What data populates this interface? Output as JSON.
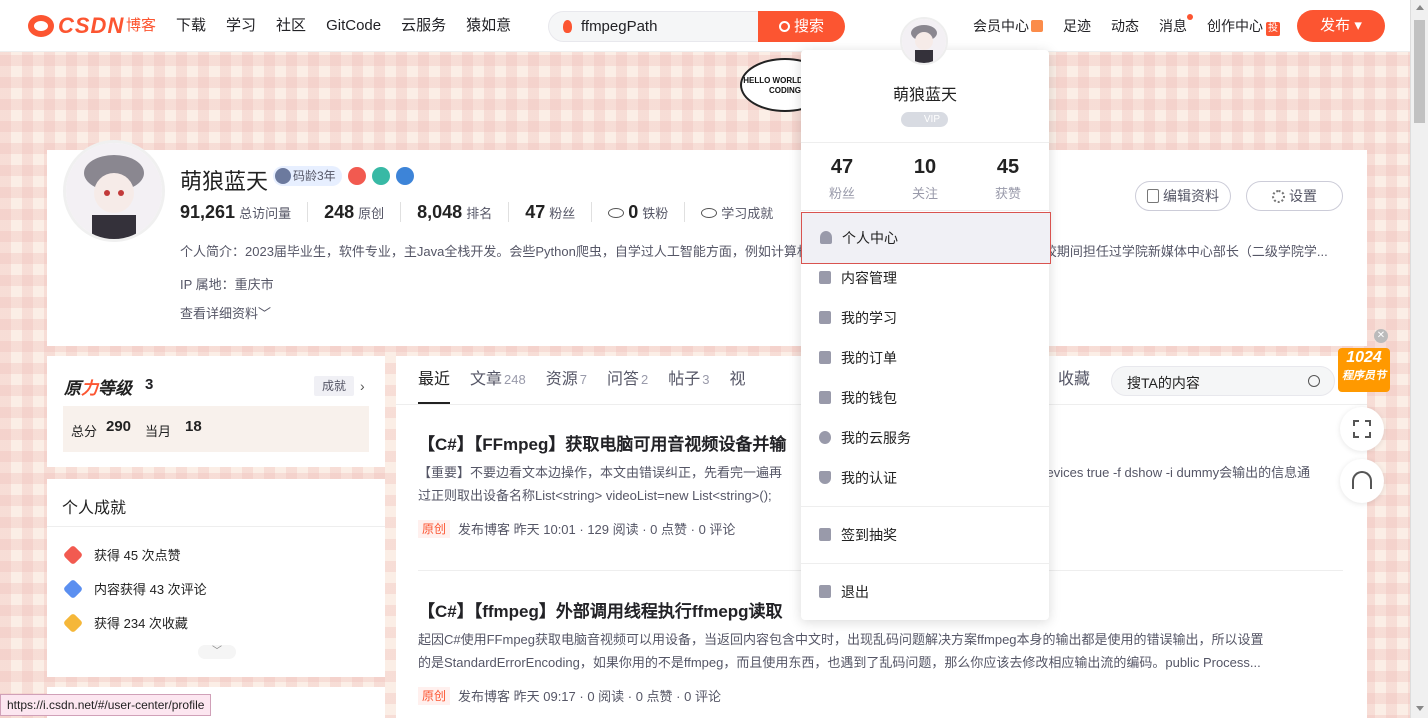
{
  "header": {
    "logo": "CSDN",
    "nav": [
      "博客",
      "下载",
      "学习",
      "社区",
      "GitCode",
      "云服务",
      "猿如意"
    ],
    "search_value": "ffmpegPath",
    "search_button": "搜索",
    "links": [
      "会员中心",
      "足迹",
      "动态",
      "消息",
      "创作中心"
    ],
    "creator_badge": "投",
    "publish": "发布"
  },
  "bubble_text": "HELLO WORLD KEEP CODING",
  "profile": {
    "username": "萌狼蓝天",
    "code_age": "码龄3年",
    "stats": [
      {
        "num": "91,261",
        "label": "总访问量"
      },
      {
        "num": "248",
        "label": "原创"
      },
      {
        "num": "8,048",
        "label": "排名"
      },
      {
        "num": "47",
        "label": "粉丝"
      },
      {
        "num": "0",
        "label": "铁粉"
      }
    ],
    "learning": "学习成就",
    "edit_btn": "编辑资料",
    "settings_btn": "设置",
    "intro": "个人简介：2023届毕业生，软件专业，主Java全栈开发。会些Python爬虫，自学过人工智能方面，例如计算机视觉与自然语言处理方面的相关知识，在校期间担任过学院新媒体中心部长（二级学院学...",
    "ip": "IP 属地：重庆市",
    "more": "查看详细资料"
  },
  "level": {
    "title_a": "原",
    "title_b": "力",
    "title_c": "等级",
    "num": "3",
    "achv_btn": "成就",
    "total_label": "总分",
    "total": "290",
    "month_label": "当月",
    "month": "18"
  },
  "achievements": {
    "title": "个人成就",
    "items": [
      "获得 45 次点赞",
      "内容获得 43 次评论",
      "获得 234 次收藏"
    ]
  },
  "tabs": [
    {
      "label": "最近",
      "count": ""
    },
    {
      "label": "文章",
      "count": "248"
    },
    {
      "label": "资源",
      "count": "7"
    },
    {
      "label": "问答",
      "count": "2"
    },
    {
      "label": "帖子",
      "count": "3"
    },
    {
      "label": "视",
      "count": ""
    }
  ],
  "tab_fav": "收藏",
  "tab_search": "搜TA的内容",
  "articles": [
    {
      "title": "【C#】【FFmpeg】获取电脑可用音视频设备并输",
      "desc_a": "【重要】不要边看文本边操作，本文由错误纠正，先看完一遍再",
      "desc_a2": "_devices true -f dshow -i dummy会输出的信息通",
      "desc_b": "过正则取出设备名称List<string> videoList=new List<string>();",
      "tag": "原创",
      "meta": "发布博客 昨天 10:01 · 129 阅读 · 0 点赞 · 0 评论"
    },
    {
      "title": "【C#】【ffmpeg】外部调用线程执行ffmepg读取",
      "desc_a": "起因C#使用FFmpeg获取电脑音视频可以用设备，当返回内容包含中文时，出现乱码问题解决方案ffmpeg本身的输出都是使用的错误输出，所以设置",
      "desc_a2": "",
      "desc_b": "的是StandardErrorEncoding，如果你用的不是ffmpeg，而且使用东西，也遇到了乱码问题，那么你应该去修改相应输出流的编码。public Process...",
      "tag": "原创",
      "meta": "发布博客 昨天 09:17 · 0 阅读 · 0 点赞 · 0 评论"
    }
  ],
  "dropdown": {
    "name": "萌狼蓝天",
    "vip": "VIP",
    "stats": [
      {
        "num": "47",
        "label": "粉丝"
      },
      {
        "num": "10",
        "label": "关注"
      },
      {
        "num": "45",
        "label": "获赞"
      }
    ],
    "items": [
      "个人中心",
      "内容管理",
      "我的学习",
      "我的订单",
      "我的钱包",
      "我的云服务",
      "我的认证",
      "签到抽奖",
      "退出"
    ]
  },
  "promo": {
    "a": "1024",
    "b": "程序员节"
  },
  "status_url": "https://i.csdn.net/#/user-center/profile"
}
